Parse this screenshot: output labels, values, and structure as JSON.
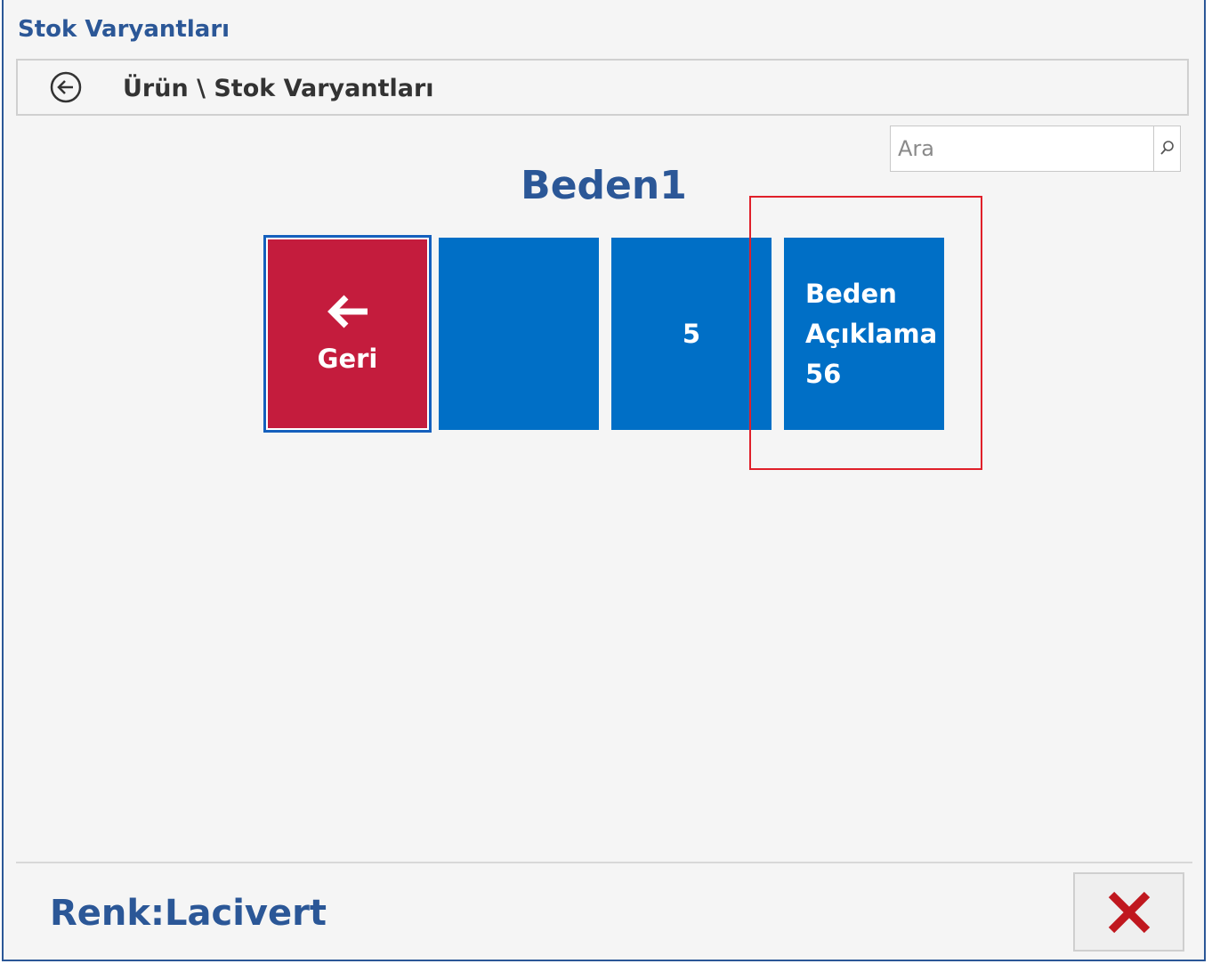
{
  "window": {
    "title": "Stok Varyantları"
  },
  "breadcrumb": {
    "text": "Ürün \\ Stok Varyantları"
  },
  "search": {
    "placeholder": "Ara",
    "value": ""
  },
  "group": {
    "title": "Beden1"
  },
  "tiles": [
    {
      "label": "Geri",
      "icon": "arrow-left-icon",
      "color": "#c41c3d"
    },
    {
      "label": "",
      "color": "#006fc6"
    },
    {
      "label": "5",
      "color": "#006fc6"
    },
    {
      "lines": [
        "Beden",
        "Açıklama",
        "56"
      ],
      "color": "#006fc6"
    }
  ],
  "footer": {
    "label": "Renk:Lacivert"
  },
  "colors": {
    "accent": "#2b5797",
    "tile_blue": "#006fc6",
    "tile_red": "#c41c3d",
    "highlight": "#e0202a",
    "close_icon": "#c0181f"
  }
}
